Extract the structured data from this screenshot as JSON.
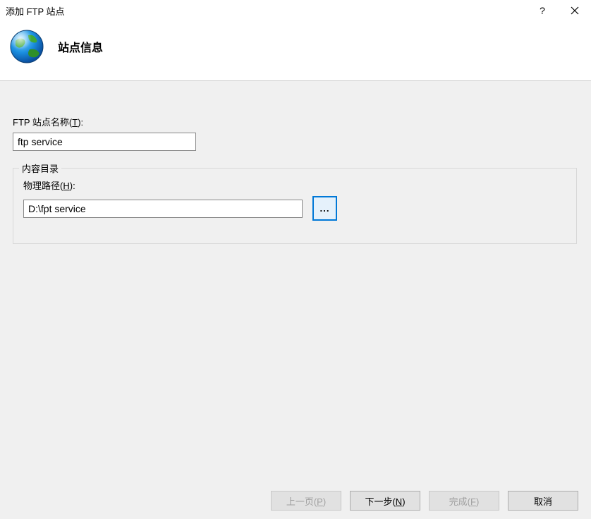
{
  "window": {
    "title": "添加 FTP 站点"
  },
  "header": {
    "title": "站点信息"
  },
  "form": {
    "site_name_label_pre": "FTP 站点名称(",
    "site_name_label_key": "T",
    "site_name_label_post": "):",
    "site_name_value": "ftp service",
    "content_dir_legend": "内容目录",
    "physical_path_label_pre": "物理路径(",
    "physical_path_label_key": "H",
    "physical_path_label_post": "):",
    "physical_path_value": "D:\\fpt service",
    "browse_label": "..."
  },
  "footer": {
    "prev_pre": "上一页(",
    "prev_key": "P",
    "prev_post": ")",
    "next_pre": "下一步(",
    "next_key": "N",
    "next_post": ")",
    "finish_pre": "完成(",
    "finish_key": "F",
    "finish_post": ")",
    "cancel": "取消"
  }
}
